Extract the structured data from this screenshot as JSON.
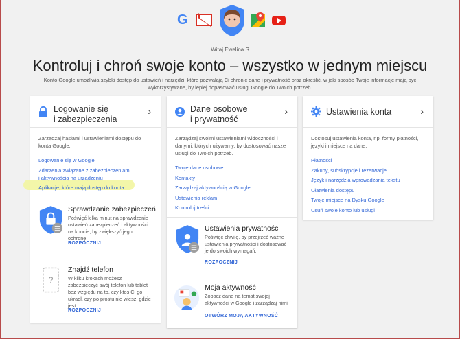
{
  "header": {
    "welcome": "Witaj Ewelina S",
    "headline": "Kontroluj i chroń swoje konto – wszystko w jednym miejscu",
    "intro": "Konto Google umożliwia szybki dostęp do ustawień i narzędzi, które pozwalają Ci chronić dane i prywatność oraz określić, w jaki sposób Twoje informacje mają być wykorzystywane, by lepiej dopasować usługi Google do Twoich potrzeb."
  },
  "app_icons": [
    "google-icon",
    "gmail-icon",
    "account-shield-icon",
    "maps-icon",
    "youtube-icon"
  ],
  "login_card": {
    "title_line1": "Logowanie się",
    "title_line2": "i zabezpieczenia",
    "desc": "Zarządzaj hasłami i ustawieniami dostępu do konta Google.",
    "links": [
      "Logowanie się w Google",
      "Zdarzenia związane z zabezpieczeniami",
      "i aktywnością na urządzeniu",
      "Aplikacje, które mają dostęp do konta"
    ],
    "security_check": {
      "title": "Sprawdzanie zabezpieczeń",
      "text": "Poświęć kilka minut na sprawdzenie ustawień zabezpieczeń i aktywności na koncie, by zwiększyć jego ochronę",
      "action": "ROZPOCZNIJ"
    },
    "find_phone": {
      "title": "Znajdź telefon",
      "text": "W kilku krokach możesz zabezpieczyć swój telefon lub tablet bez względu na to, czy ktoś Ci go ukradł, czy po prostu nie wiesz, gdzie jest",
      "action": "ROZPOCZNIJ"
    }
  },
  "personal_card": {
    "title_line1": "Dane osobowe",
    "title_line2": "i prywatność",
    "desc": "Zarządzaj swoimi ustawieniami widoczności i danymi, których używamy, by dostosować nasze usługi do Twoich potrzeb.",
    "links": [
      "Twoje dane osobowe",
      "Kontakty",
      "Zarządzaj aktywnością w Google",
      "Ustawienia reklam",
      "Kontroluj treści"
    ],
    "privacy_check": {
      "title": "Ustawienia prywatności",
      "text": "Poświęć chwilę, by przejrzeć ważne ustawienia prywatności i dostosować je do swoich wymagań.",
      "action": "ROZPOCZNIJ"
    },
    "my_activity": {
      "title": "Moja aktywność",
      "text": "Zobacz dane na temat swojej aktywności w Google i zarządzaj nimi",
      "action": "OTWÓRZ MOJĄ AKTYWNOŚĆ"
    }
  },
  "settings_card": {
    "title": "Ustawienia konta",
    "desc": "Dostosuj ustawienia konta, np. formy płatności, języki i miejsce na dane.",
    "links": [
      "Płatności",
      "Zakupy, subskrypcje i rezerwacje",
      "Język i narzędzia wprowadzania tekstu",
      "Ułatwienia dostępu",
      "Twoje miejsce na Dysku Google",
      "Usuń swoje konto lub usługi"
    ]
  },
  "colors": {
    "link": "#3367d6",
    "accent_blue": "#4285f4",
    "highlight": "#f2f5a0"
  }
}
